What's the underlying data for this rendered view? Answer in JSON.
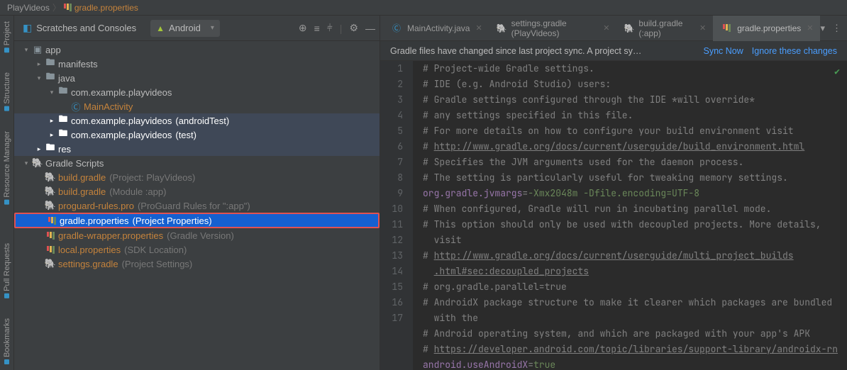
{
  "breadcrumb": {
    "project": "PlayVideos",
    "file": "gradle.properties"
  },
  "panel": {
    "title": "Scratches and Consoles",
    "selector": "Android"
  },
  "rails": {
    "top": [
      "Project",
      "Structure",
      "Resource Manager"
    ],
    "bottom": [
      "Pull Requests",
      "Bookmarks"
    ]
  },
  "tree": [
    {
      "depth": 0,
      "chev": "▾",
      "icon": "app",
      "label": "app"
    },
    {
      "depth": 1,
      "chev": "▸",
      "icon": "folder",
      "label": "manifests"
    },
    {
      "depth": 1,
      "chev": "▾",
      "icon": "folder",
      "label": "java"
    },
    {
      "depth": 2,
      "chev": "▾",
      "icon": "folder",
      "label": "com.example.playvideos"
    },
    {
      "depth": 3,
      "chev": "",
      "icon": "kotlin",
      "label": "MainActivity",
      "orange": true
    },
    {
      "depth": 2,
      "chev": "▸",
      "icon": "folder",
      "label": "com.example.playvideos",
      "suffix": "(androidTest)",
      "bg": true
    },
    {
      "depth": 2,
      "chev": "▸",
      "icon": "folder",
      "label": "com.example.playvideos",
      "suffix": "(test)",
      "bg": true
    },
    {
      "depth": 1,
      "chev": "▸",
      "icon": "folder",
      "label": "res",
      "bg": true
    },
    {
      "depth": 0,
      "chev": "▾",
      "icon": "gradle",
      "label": "Gradle Scripts"
    },
    {
      "depth": 1,
      "chev": "",
      "icon": "gradle-file",
      "label": "build.gradle",
      "suffix": "(Project: PlayVideos)",
      "orange": true
    },
    {
      "depth": 1,
      "chev": "",
      "icon": "gradle-file",
      "label": "build.gradle",
      "suffix": "(Module :app)",
      "orange": true
    },
    {
      "depth": 1,
      "chev": "",
      "icon": "gradle-file",
      "label": "proguard-rules.pro",
      "suffix": "(ProGuard Rules for \":app\")",
      "orange": true
    },
    {
      "depth": 1,
      "chev": "",
      "icon": "prop",
      "label": "gradle.properties",
      "suffix": "(Project Properties)",
      "selected": true
    },
    {
      "depth": 1,
      "chev": "",
      "icon": "prop",
      "label": "gradle-wrapper.properties",
      "suffix": "(Gradle Version)",
      "orange": true
    },
    {
      "depth": 1,
      "chev": "",
      "icon": "prop",
      "label": "local.properties",
      "suffix": "(SDK Location)",
      "orange": true
    },
    {
      "depth": 1,
      "chev": "",
      "icon": "gradle-file",
      "label": "settings.gradle",
      "suffix": "(Project Settings)",
      "orange": true
    }
  ],
  "tabs": [
    {
      "icon": "kotlin",
      "label": "MainActivity.java"
    },
    {
      "icon": "gradle-file",
      "label": "settings.gradle (PlayVideos)"
    },
    {
      "icon": "gradle-file",
      "label": "build.gradle (:app)"
    },
    {
      "icon": "prop",
      "label": "gradle.properties",
      "active": true
    }
  ],
  "notify": {
    "text": "Gradle files have changed since last project sync. A project sy…",
    "link1": "Sync Now",
    "link2": "Ignore these changes"
  },
  "code": [
    {
      "n": 1,
      "t": "# Project-wide Gradle settings."
    },
    {
      "n": 2,
      "t": "# IDE (e.g. Android Studio) users:"
    },
    {
      "n": 3,
      "t": "# Gradle settings configured through the IDE *will override*"
    },
    {
      "n": 4,
      "t": "# any settings specified in this file."
    },
    {
      "n": 5,
      "t": "# For more details on how to configure your build environment visit"
    },
    {
      "n": 6,
      "pre": "# ",
      "link": "http://www.gradle.org/docs/current/userguide/build_environment.html"
    },
    {
      "n": 7,
      "t": "# Specifies the JVM arguments used for the daemon process."
    },
    {
      "n": 8,
      "t": "# The setting is particularly useful for tweaking memory settings."
    },
    {
      "n": 9,
      "key": "org.gradle.jvmargs",
      "val": "-Xmx2048m -Dfile.encoding=UTF-8"
    },
    {
      "n": 10,
      "t": "# When configured, Gradle will run in incubating parallel mode."
    },
    {
      "n": 11,
      "t": "# This option should only be used with decoupled projects. More details,"
    },
    {
      "n": "",
      "t": "  visit"
    },
    {
      "n": 12,
      "pre": "# ",
      "link": "http://www.gradle.org/docs/current/userguide/multi_project_builds"
    },
    {
      "n": "",
      "link": ".html#sec:decoupled_projects",
      "indent": true
    },
    {
      "n": 13,
      "t": "# org.gradle.parallel=true"
    },
    {
      "n": 14,
      "t": "# AndroidX package structure to make it clearer which packages are bundled"
    },
    {
      "n": "",
      "t": "  with the"
    },
    {
      "n": 15,
      "t": "# Android operating system, and which are packaged with your app's APK"
    },
    {
      "n": 16,
      "pre": "# ",
      "link": "https://developer.android.com/topic/libraries/support-library/androidx-rn"
    },
    {
      "n": 17,
      "key": "android.useAndroidX",
      "val": "true"
    }
  ]
}
